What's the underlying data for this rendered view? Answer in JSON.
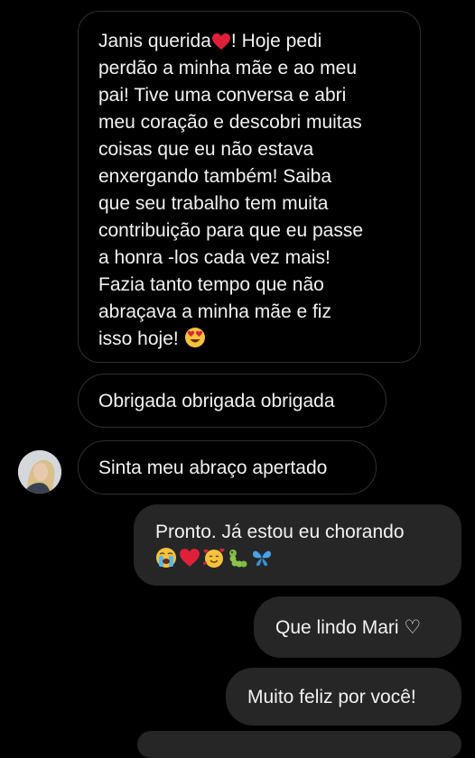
{
  "conversation": {
    "messages": [
      {
        "direction": "incoming",
        "lines": [
          "Janis querida",
          "! Hoje pedi",
          "perdão a minha mãe e ao meu",
          "pai! Tive uma conversa e abri",
          "meu coração e descobri muitas",
          "coisas que eu não estava",
          "enxergando também! Saiba",
          "que seu trabalho tem muita",
          "contribuição para que eu passe",
          "a honra -los cada vez mais!",
          "Fazia tanto tempo que não",
          "abraçava a minha mãe e fiz",
          "isso hoje!"
        ]
      },
      {
        "direction": "incoming",
        "text": "Obrigada obrigada obrigada"
      },
      {
        "direction": "incoming",
        "text": "Sinta meu abraço apertado"
      },
      {
        "direction": "outgoing",
        "text": "Pronto. Já estou eu chorando",
        "emojis": [
          "crying-face-emoji",
          "red-heart-emoji",
          "smiling-face-with-hearts-emoji",
          "caterpillar-emoji",
          "butterfly-emoji"
        ]
      },
      {
        "direction": "outgoing",
        "text": "Que lindo Mari ♡"
      },
      {
        "direction": "outgoing",
        "text": "Muito feliz por você!"
      }
    ]
  },
  "colors": {
    "background": "#000000",
    "incoming_border": "#2f2f2f",
    "outgoing_bubble": "#262626",
    "text": "#f2f2f2"
  }
}
